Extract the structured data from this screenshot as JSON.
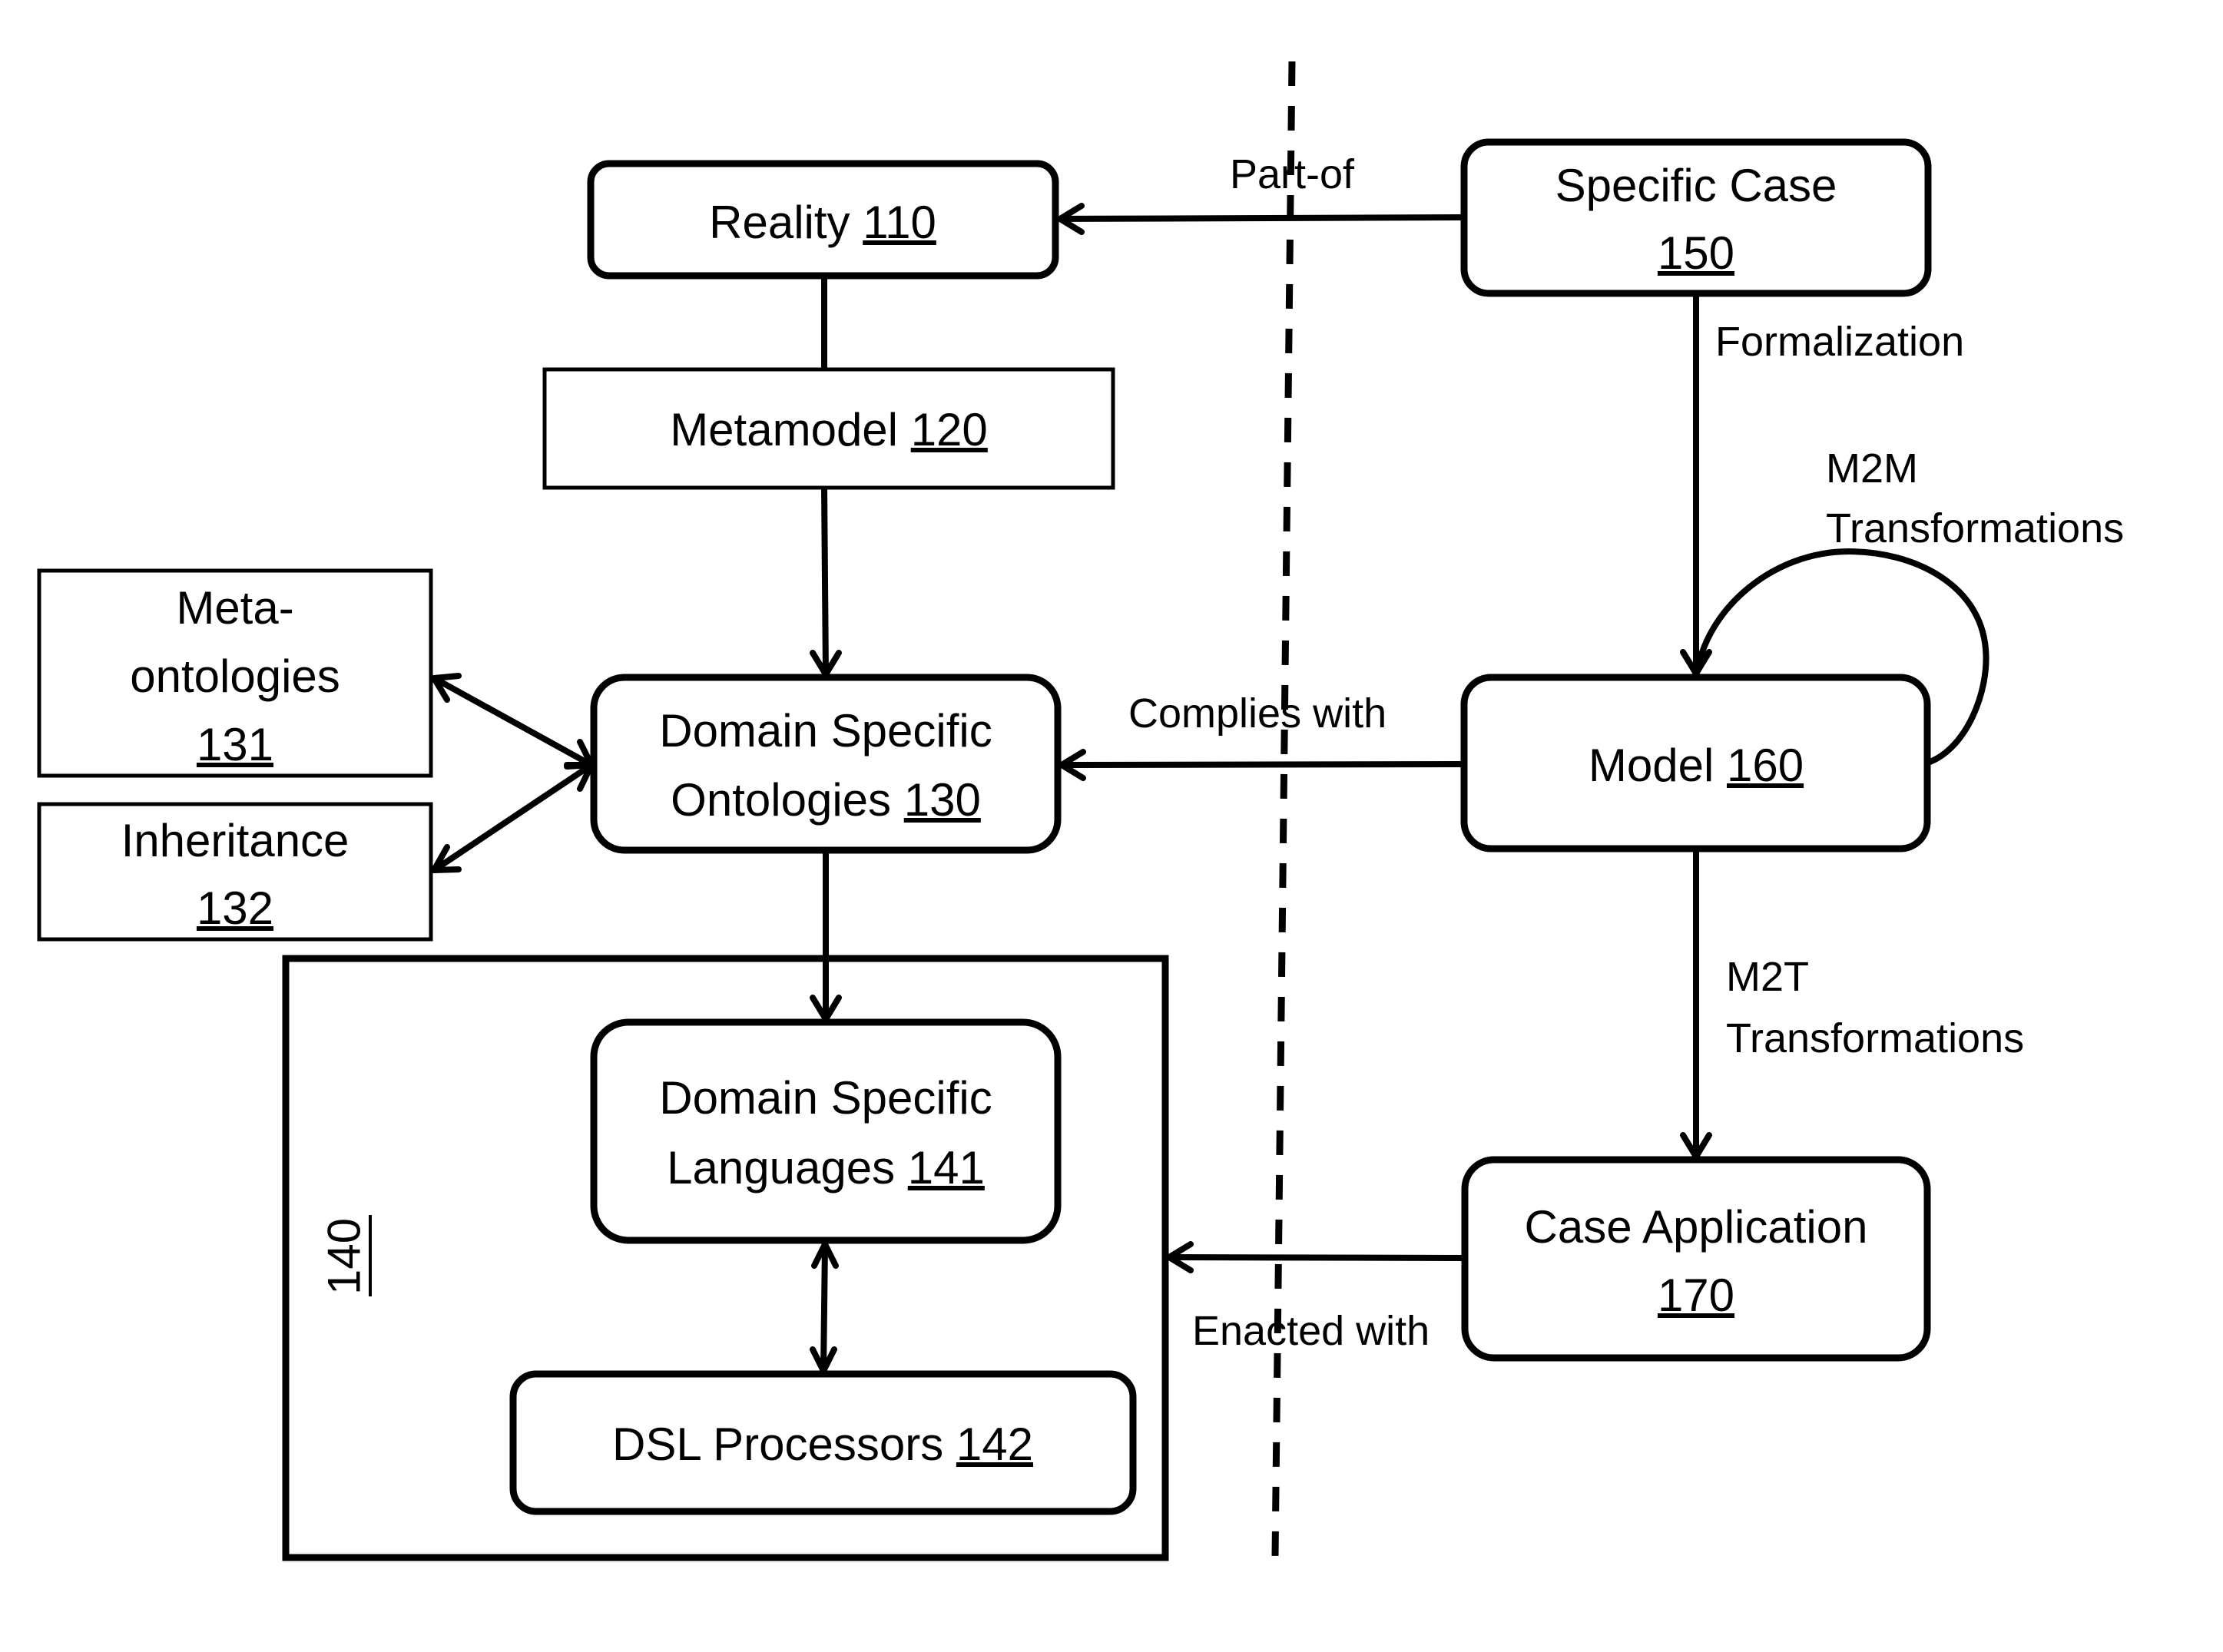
{
  "nodes": {
    "reality": {
      "label": "Reality",
      "ref": "110"
    },
    "metamodel": {
      "label": "Metamodel",
      "ref": "120"
    },
    "dso": {
      "line1": "Domain Specific",
      "line2": "Ontologies",
      "ref": "130"
    },
    "meta_ontologies": {
      "line1": "Meta-",
      "line2": "ontologies",
      "ref": "131"
    },
    "inheritance": {
      "line1": "Inheritance",
      "ref": "132"
    },
    "group": {
      "ref": "140"
    },
    "dsl": {
      "line1": "Domain Specific",
      "line2": "Languages",
      "ref": "141"
    },
    "dsl_processors": {
      "label": "DSL Processors",
      "ref": "142"
    },
    "specific_case": {
      "line1": "Specific Case",
      "ref": "150"
    },
    "model": {
      "label": "Model",
      "ref": "160"
    },
    "case_application": {
      "line1": "Case Application",
      "ref": "170"
    }
  },
  "edges": {
    "part_of": "Part-of",
    "formalization": "Formalization",
    "m2m_line1": "M2M",
    "m2m_line2": "Transformations",
    "complies_with": "Complies with",
    "m2t_line1": "M2T",
    "m2t_line2": "Transformations",
    "enacted_with": "Enacted with"
  },
  "colors": {
    "stroke": "#000000",
    "background": "#ffffff"
  }
}
